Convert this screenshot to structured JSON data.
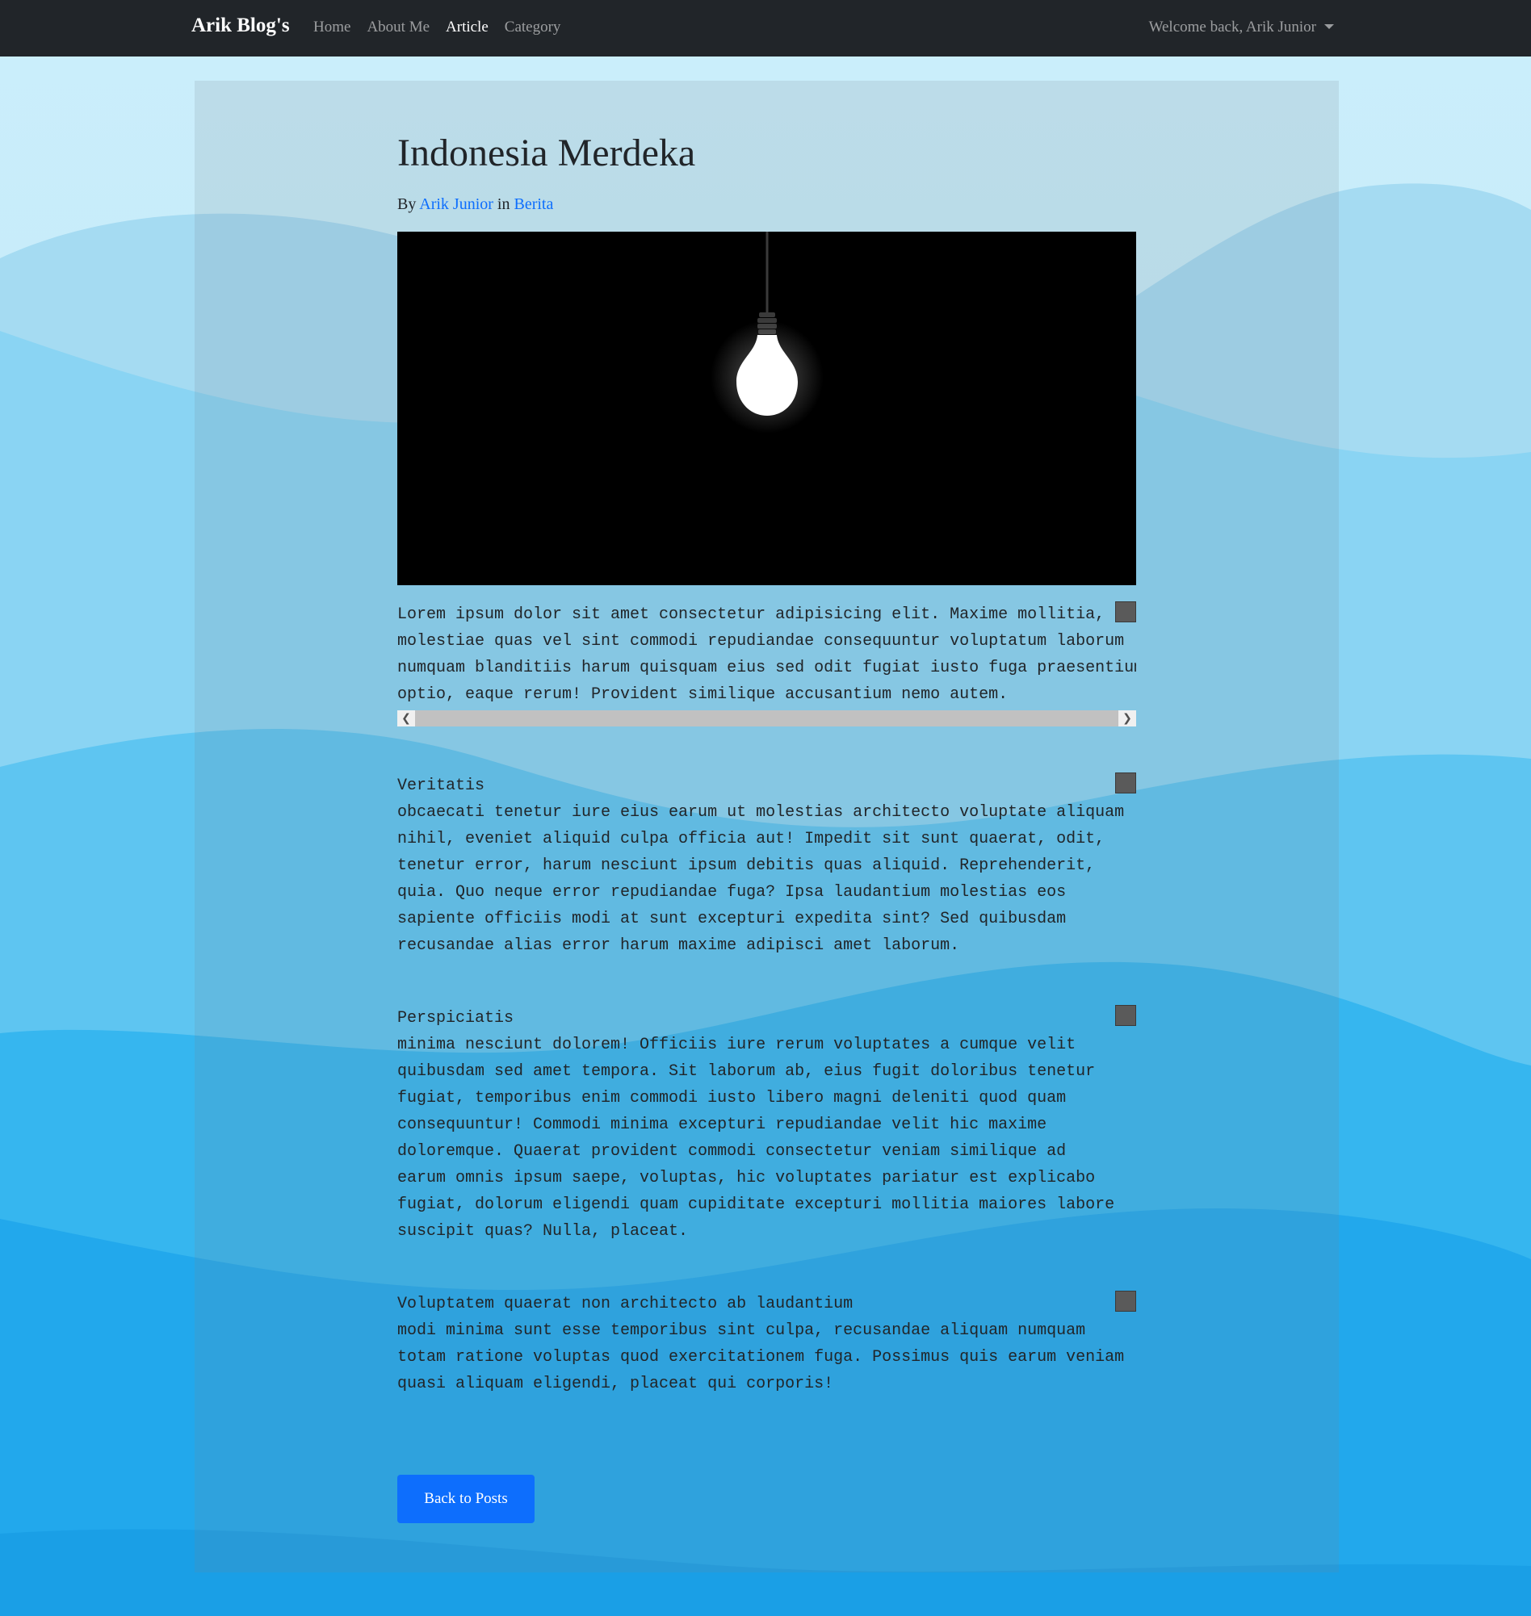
{
  "colors": {
    "navbar": "#212529",
    "link": "#0d6efd",
    "button": "#0d6efd",
    "bg_light": "#c8ecfa",
    "bg_dark": "#1ca1e8"
  },
  "navbar": {
    "brand": "Arik Blog's",
    "links": [
      "Home",
      "About Me",
      "Article",
      "Category"
    ],
    "active_link": "Article",
    "user_menu": "Welcome back, Arik Junior"
  },
  "post": {
    "title": "Indonesia Merdeka",
    "by_label": "By",
    "author": "Arik Junior",
    "in_label": "in",
    "category": "Berita",
    "image_icon": "light-bulb-image",
    "intro": "Lorem ipsum dolor sit amet consectetur adipisicing elit. Maxime mollitia,",
    "intro_lines": [
      "Lorem ipsum dolor sit amet consectetur adipisicing elit. Maxime mollitia,",
      "molestiae quas vel sint commodi repudiandae consequuntur voluptatum laborum",
      "numquam blanditiis harum quisquam eius sed odit fugiat iusto fuga praesentium",
      "optio, eaque rerum! Provident similique accusantium nemo autem."
    ],
    "sections": [
      {
        "heading": "Veritatis",
        "lines": [
          "obcaecati tenetur iure eius earum ut molestias architecto voluptate aliquam",
          "nihil, eveniet aliquid culpa officia aut! Impedit sit sunt quaerat, odit,",
          "tenetur error, harum nesciunt ipsum debitis quas aliquid. Reprehenderit,",
          "quia. Quo neque error repudiandae fuga? Ipsa laudantium molestias eos",
          "sapiente officiis modi at sunt excepturi expedita sint? Sed quibusdam",
          "recusandae alias error harum maxime adipisci amet laborum."
        ]
      },
      {
        "heading": "Perspiciatis",
        "lines": [
          "minima nesciunt dolorem! Officiis iure rerum voluptates a cumque velit",
          "quibusdam sed amet tempora. Sit laborum ab, eius fugit doloribus tenetur",
          "fugiat, temporibus enim commodi iusto libero magni deleniti quod quam",
          "consequuntur! Commodi minima excepturi repudiandae velit hic maxime",
          "doloremque. Quaerat provident commodi consectetur veniam similique ad",
          "earum omnis ipsum saepe, voluptas, hic voluptates pariatur est explicabo",
          "fugiat, dolorum eligendi quam cupiditate excepturi mollitia maiores labore",
          "suscipit quas? Nulla, placeat."
        ]
      },
      {
        "heading": "Voluptatem quaerat non architecto ab laudantium",
        "lines": [
          "modi minima sunt esse temporibus sint culpa, recusandae aliquam numquam",
          "totam ratione voluptas quod exercitationem fuga. Possimus quis earum veniam",
          "quasi aliquam eligendi, placeat qui corporis!"
        ]
      }
    ],
    "back_button": "Back to Posts"
  }
}
